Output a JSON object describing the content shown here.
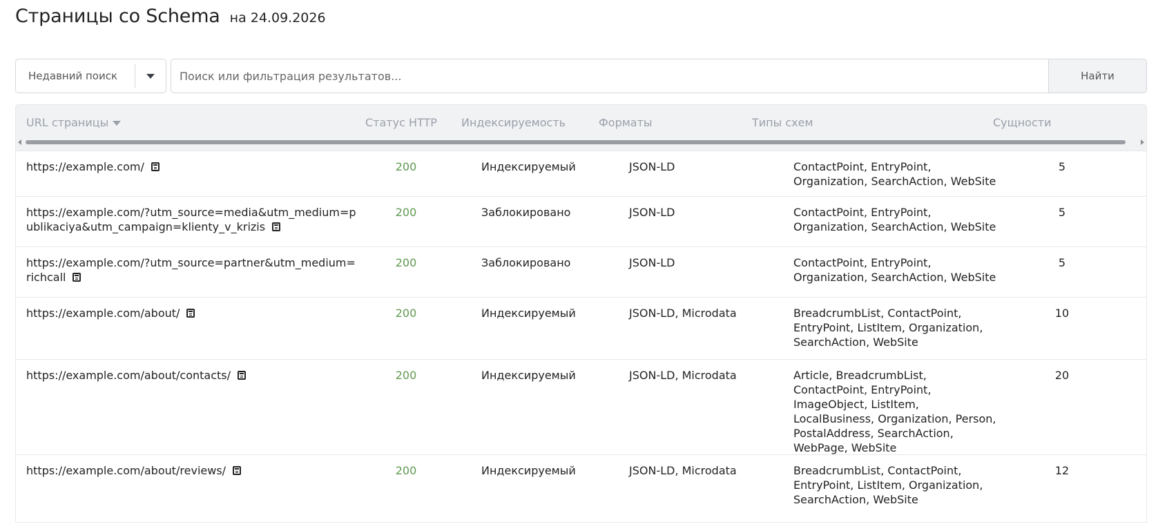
{
  "header": {
    "title": "Страницы со Schema",
    "date": "на 24.09.2026"
  },
  "search": {
    "recent_label": "Недавний поиск",
    "placeholder": "Поиск или фильтрация результатов...",
    "find_label": "Найти"
  },
  "table": {
    "columns": {
      "url": "URL страницы",
      "status": "Статус HTTP",
      "indexability": "Индексируемость",
      "formats": "Форматы",
      "schema_types": "Типы схем",
      "entities": "Сущности"
    },
    "rows": [
      {
        "url": "https://example.com/",
        "status": "200",
        "indexability": "Индексируемый",
        "formats": "JSON-LD",
        "schema_types": "ContactPoint, EntryPoint, Organization, SearchAction, WebSite",
        "entities": "5"
      },
      {
        "url": "https://example.com/?utm_source=media&utm_medium=publikaciya&utm_campaign=klienty_v_krizis",
        "status": "200",
        "indexability": "Заблокировано",
        "formats": "JSON-LD",
        "schema_types": "ContactPoint, EntryPoint, Organization, SearchAction, WebSite",
        "entities": "5"
      },
      {
        "url": "https://example.com/?utm_source=partner&utm_medium=richcall",
        "status": "200",
        "indexability": "Заблокировано",
        "formats": "JSON-LD",
        "schema_types": "ContactPoint, EntryPoint, Organization, SearchAction, WebSite",
        "entities": "5"
      },
      {
        "url": "https://example.com/about/",
        "status": "200",
        "indexability": "Индексируемый",
        "formats": "JSON-LD, Microdata",
        "schema_types": "BreadcrumbList, ContactPoint, EntryPoint, ListItem, Organization, SearchAction, WebSite",
        "entities": "10"
      },
      {
        "url": "https://example.com/about/contacts/",
        "status": "200",
        "indexability": "Индексируемый",
        "formats": "JSON-LD, Microdata",
        "schema_types": "Article, BreadcrumbList, ContactPoint, EntryPoint, ImageObject, ListItem, LocalBusiness, Organization, Person, PostalAddress, SearchAction, WebPage, WebSite",
        "entities": "20"
      },
      {
        "url": "https://example.com/about/reviews/",
        "status": "200",
        "indexability": "Индексируемый",
        "formats": "JSON-LD, Microdata",
        "schema_types": "BreadcrumbList, ContactPoint, EntryPoint, ListItem, Organization, SearchAction, WebSite",
        "entities": "12"
      }
    ]
  },
  "colors": {
    "status_ok": "#5f9950",
    "header_bg": "#f1f2f4",
    "header_text": "#9aa0aa"
  }
}
